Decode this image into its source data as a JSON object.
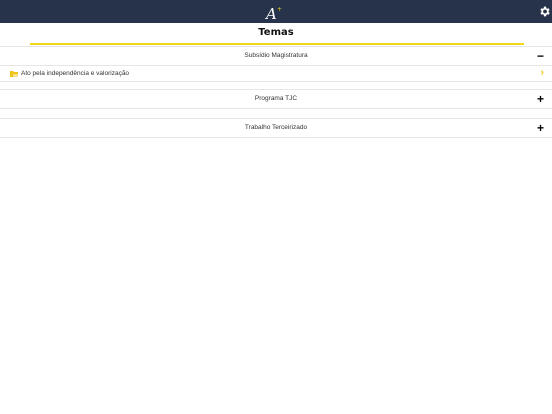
{
  "app": {
    "logo_text": "A",
    "logo_sup": "+"
  },
  "header": {
    "title": "Temas"
  },
  "sections": [
    {
      "label": "Subsídio Magistratura",
      "toggle": "−",
      "expanded": true,
      "items": [
        {
          "label": "Ato pela independência e valorização",
          "icon": "folder-icon"
        }
      ]
    },
    {
      "label": "Programa TJC",
      "toggle": "+",
      "expanded": false
    },
    {
      "label": "Trabalho Terceirizado",
      "toggle": "+",
      "expanded": false
    }
  ],
  "colors": {
    "topbar": "#27334a",
    "accent": "#f0d817"
  }
}
